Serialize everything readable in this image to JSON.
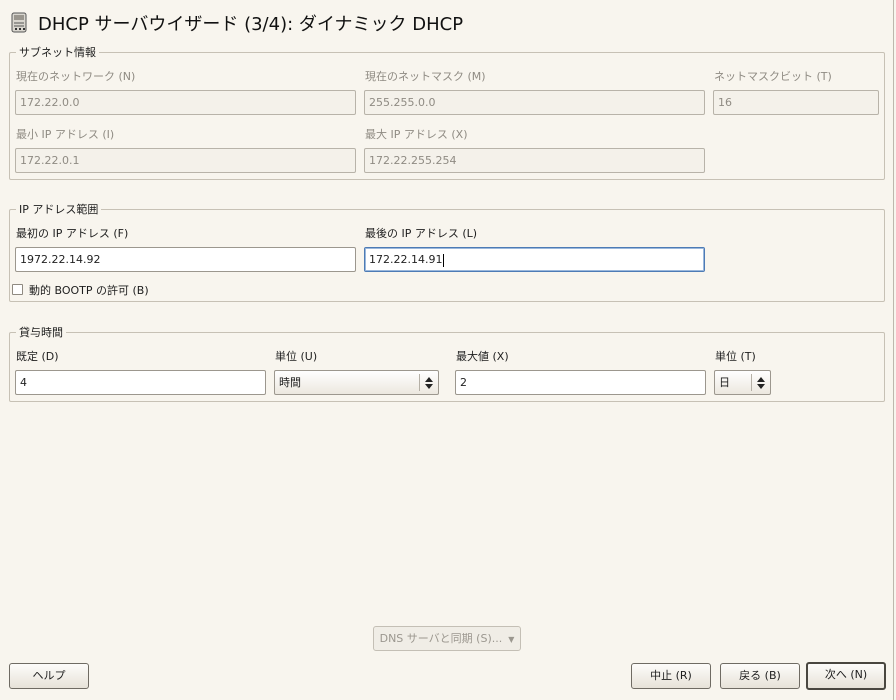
{
  "window": {
    "title": "DHCP サーバウイザード (3/4): ダイナミック DHCP",
    "icon": "server-icon"
  },
  "subnet": {
    "legend": "サブネット情報",
    "network_label": "現在のネットワーク (N)",
    "network_value": "172.22.0.0",
    "netmask_label": "現在のネットマスク (M)",
    "netmask_value": "255.255.0.0",
    "netmask_bits_label": "ネットマスクビット (T)",
    "netmask_bits_value": "16",
    "min_ip_label": "最小 IP アドレス (I)",
    "min_ip_value": "172.22.0.1",
    "max_ip_label": "最大 IP アドレス (X)",
    "max_ip_value": "172.22.255.254"
  },
  "range": {
    "legend": "IP アドレス範囲",
    "first_ip_label": "最初の IP アドレス (F)",
    "first_ip_value": "1972.22.14.92",
    "last_ip_label": "最後の IP アドレス (L)",
    "last_ip_value": "172.22.14.91",
    "bootp_label": "動的 BOOTP の許可 (B)",
    "bootp_checked": false
  },
  "lease": {
    "legend": "貸与時間",
    "default_label": "既定 (D)",
    "default_value": "4",
    "default_unit_label": "単位 (U)",
    "default_unit_value": "時間",
    "max_label": "最大値 (X)",
    "max_value": "2",
    "max_unit_label": "単位 (T)",
    "max_unit_value": "日"
  },
  "dns_sync_button": "DNS サーバと同期 (S)...",
  "buttons": {
    "help": "ヘルプ",
    "abort": "中止 (R)",
    "back": "戻る (B)",
    "next": "次へ (N)"
  }
}
